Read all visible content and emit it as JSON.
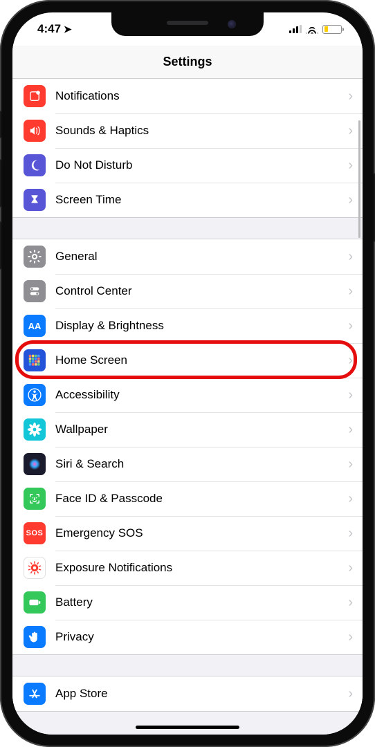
{
  "status": {
    "time": "4:47",
    "location_services": true
  },
  "page": {
    "title": "Settings"
  },
  "highlighted_row_id": "home-screen",
  "groups": [
    {
      "id": "g1",
      "rows": [
        {
          "id": "notifications",
          "label": "Notifications",
          "icon": "notifications-icon",
          "bg": "#ff3b30"
        },
        {
          "id": "sounds-haptics",
          "label": "Sounds & Haptics",
          "icon": "speaker-icon",
          "bg": "#ff3b30"
        },
        {
          "id": "do-not-disturb",
          "label": "Do Not Disturb",
          "icon": "moon-icon",
          "bg": "#5856d6"
        },
        {
          "id": "screen-time",
          "label": "Screen Time",
          "icon": "hourglass-icon",
          "bg": "#5856d6"
        }
      ]
    },
    {
      "id": "g2",
      "rows": [
        {
          "id": "general",
          "label": "General",
          "icon": "gear-icon",
          "bg": "#8e8e93"
        },
        {
          "id": "control-center",
          "label": "Control Center",
          "icon": "toggles-icon",
          "bg": "#8e8e93"
        },
        {
          "id": "display-brightness",
          "label": "Display & Brightness",
          "icon": "aa-icon",
          "bg": "#0a7aff"
        },
        {
          "id": "home-screen",
          "label": "Home Screen",
          "icon": "grid-icon",
          "bg": "#2353d9"
        },
        {
          "id": "accessibility",
          "label": "Accessibility",
          "icon": "accessibility-icon",
          "bg": "#0a7aff"
        },
        {
          "id": "wallpaper",
          "label": "Wallpaper",
          "icon": "flower-icon",
          "bg": "#13c7d8"
        },
        {
          "id": "siri-search",
          "label": "Siri & Search",
          "icon": "siri-icon",
          "bg": "#1b1b2e"
        },
        {
          "id": "face-id-passcode",
          "label": "Face ID & Passcode",
          "icon": "face-id-icon",
          "bg": "#34c759"
        },
        {
          "id": "emergency-sos",
          "label": "Emergency SOS",
          "icon": "sos-icon",
          "bg": "#ff3b30"
        },
        {
          "id": "exposure-notifications",
          "label": "Exposure Notifications",
          "icon": "virus-icon",
          "bg": "#ffffff"
        },
        {
          "id": "battery",
          "label": "Battery",
          "icon": "battery-icon",
          "bg": "#34c759"
        },
        {
          "id": "privacy",
          "label": "Privacy",
          "icon": "hand-icon",
          "bg": "#0a7aff"
        }
      ]
    },
    {
      "id": "g3",
      "rows": [
        {
          "id": "app-store",
          "label": "App Store",
          "icon": "appstore-icon",
          "bg": "#0a7aff"
        }
      ]
    }
  ],
  "icon_glyphs": {
    "notifications-icon": "▢",
    "speaker-icon": "🔊",
    "moon-icon": "☾",
    "hourglass-icon": "⧗",
    "gear-icon": "⚙",
    "toggles-icon": "⌬",
    "aa-icon": "AA",
    "grid-icon": "▦",
    "accessibility-icon": "◉",
    "flower-icon": "❀",
    "siri-icon": "◯",
    "face-id-icon": "⊡",
    "sos-icon": "SOS",
    "virus-icon": "✺",
    "battery-icon": "▬",
    "hand-icon": "✋",
    "appstore-icon": "Ⓐ"
  }
}
